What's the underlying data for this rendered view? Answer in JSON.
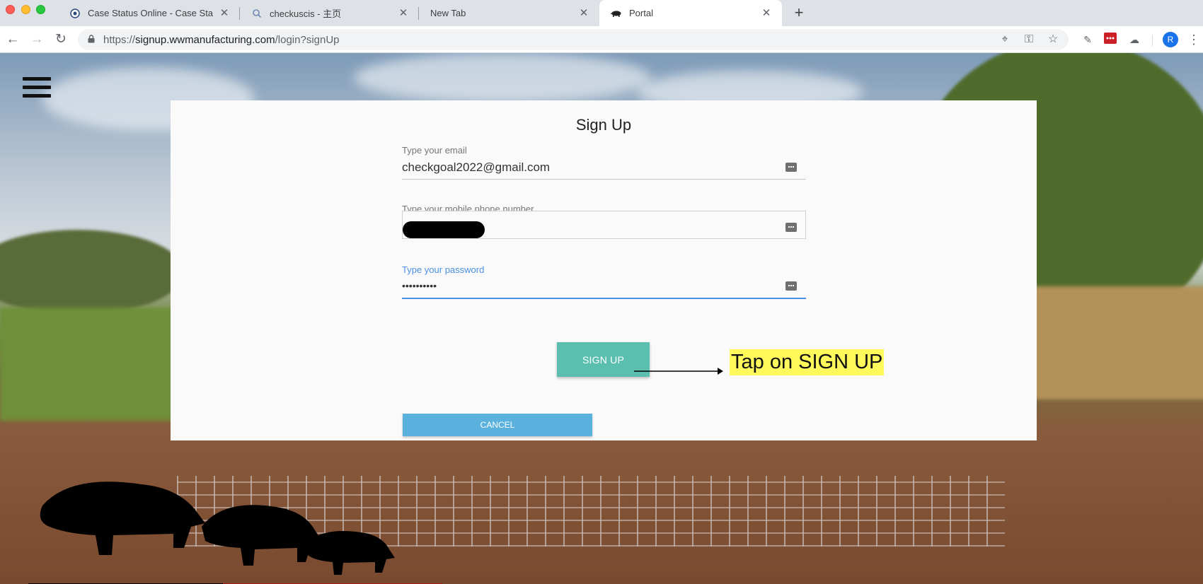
{
  "browser": {
    "tabs": [
      {
        "title": "Case Status Online - Case Stat",
        "icon": "seal-icon",
        "active": false
      },
      {
        "title": "checkuscis - 主页",
        "icon": "search-icon",
        "active": false
      },
      {
        "title": "New Tab",
        "icon": "",
        "active": false
      },
      {
        "title": "Portal",
        "icon": "boar-icon",
        "active": true
      }
    ],
    "url_scheme": "https://",
    "url_host": "signup.wwmanufacturing.com",
    "url_path": "/login?signUp",
    "profile_initial": "R"
  },
  "form": {
    "title": "Sign Up",
    "email_label": "Type your email",
    "email_value": "checkgoal2022@gmail.com",
    "phone_label": "Type your mobile phone number",
    "phone_value": "",
    "password_label": "Type your password",
    "password_value": "••••••••••",
    "signup_label": "SIGN UP",
    "cancel_label": "CANCEL"
  },
  "annotation": {
    "callout_text": "Tap on SIGN UP",
    "highlight_color": "#fff95b"
  },
  "colors": {
    "signup_button": "#5bbfb0",
    "cancel_button": "#5bb1de",
    "focus_accent": "#4a90e2"
  }
}
